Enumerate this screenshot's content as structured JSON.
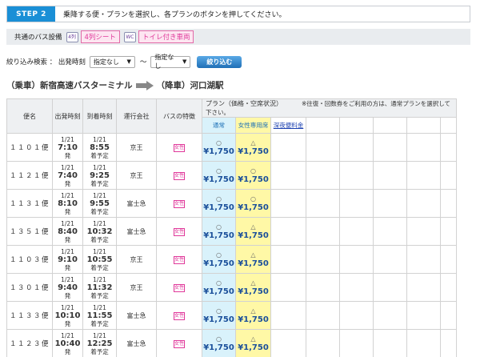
{
  "step": {
    "tag": "STEP 2",
    "text": "乗降する便・プランを選択し、各プランのボタンを押してください。"
  },
  "facilities": {
    "label": "共通のバス設備",
    "icon1": "4列",
    "seat4_label": "4列シート",
    "icon2": "WC",
    "toilet_label": "トイレ付き車両"
  },
  "filter": {
    "label": "絞り込み検索 ： 出発時刻",
    "from": "指定なし",
    "tilde": "〜",
    "to": "指定なし",
    "button": "絞り込む"
  },
  "route": {
    "from": "（乗車）新宿高速バスターミナル",
    "to": "（降車）河口湖駅"
  },
  "table": {
    "headers": {
      "name": "便名",
      "dep": "出発時刻",
      "arr": "到着時刻",
      "op": "運行会社",
      "bus": "バスの特徴",
      "plan": "プラン（価格・空席状況）",
      "note": "※往復・回数券をご利用の方は、通常プランを選択して下さい。"
    },
    "plans": [
      "通常",
      "女性専用席",
      "深夜便料金"
    ],
    "bus_icon": "女性",
    "rows": [
      {
        "name": "１１０１便",
        "dep_date": "1/21",
        "dep": "7:10",
        "dep_s": "発",
        "arr_date": "1/21",
        "arr": "8:55",
        "arr_s": "着予定",
        "op": "京王",
        "r_mark": "○",
        "r_price": "¥1,750",
        "l_mark": "△",
        "l_price": "¥1,750"
      },
      {
        "name": "１１２１便",
        "dep_date": "1/21",
        "dep": "7:40",
        "dep_s": "発",
        "arr_date": "1/21",
        "arr": "9:25",
        "arr_s": "着予定",
        "op": "京王",
        "r_mark": "○",
        "r_price": "¥1,750",
        "l_mark": "○",
        "l_price": "¥1,750"
      },
      {
        "name": "１１３１便",
        "dep_date": "1/21",
        "dep": "8:10",
        "dep_s": "発",
        "arr_date": "1/21",
        "arr": "9:55",
        "arr_s": "着予定",
        "op": "富士急",
        "r_mark": "○",
        "r_price": "¥1,750",
        "l_mark": "○",
        "l_price": "¥1,750"
      },
      {
        "name": "１３５１便",
        "dep_date": "1/21",
        "dep": "8:40",
        "dep_s": "発",
        "arr_date": "1/21",
        "arr": "10:32",
        "arr_s": "着予定",
        "op": "富士急",
        "r_mark": "○",
        "r_price": "¥1,750",
        "l_mark": "△",
        "l_price": "¥1,750"
      },
      {
        "name": "１１０３便",
        "dep_date": "1/21",
        "dep": "9:10",
        "dep_s": "発",
        "arr_date": "1/21",
        "arr": "10:55",
        "arr_s": "着予定",
        "op": "京王",
        "r_mark": "○",
        "r_price": "¥1,750",
        "l_mark": "△",
        "l_price": "¥1,750"
      },
      {
        "name": "１３０１便",
        "dep_date": "1/21",
        "dep": "9:40",
        "dep_s": "発",
        "arr_date": "1/21",
        "arr": "11:32",
        "arr_s": "着予定",
        "op": "京王",
        "r_mark": "○",
        "r_price": "¥1,750",
        "l_mark": "△",
        "l_price": "¥1,750"
      },
      {
        "name": "１１３３便",
        "dep_date": "1/21",
        "dep": "10:10",
        "dep_s": "発",
        "arr_date": "1/21",
        "arr": "11:55",
        "arr_s": "着予定",
        "op": "富士急",
        "r_mark": "○",
        "r_price": "¥1,750",
        "l_mark": "△",
        "l_price": "¥1,750"
      },
      {
        "name": "１１２３便",
        "dep_date": "1/21",
        "dep": "10:40",
        "dep_s": "発",
        "arr_date": "1/21",
        "arr": "12:25",
        "arr_s": "着予定",
        "op": "富士急",
        "r_mark": "○",
        "r_price": "¥1,750",
        "l_mark": "△",
        "l_price": "¥1,750"
      }
    ]
  }
}
